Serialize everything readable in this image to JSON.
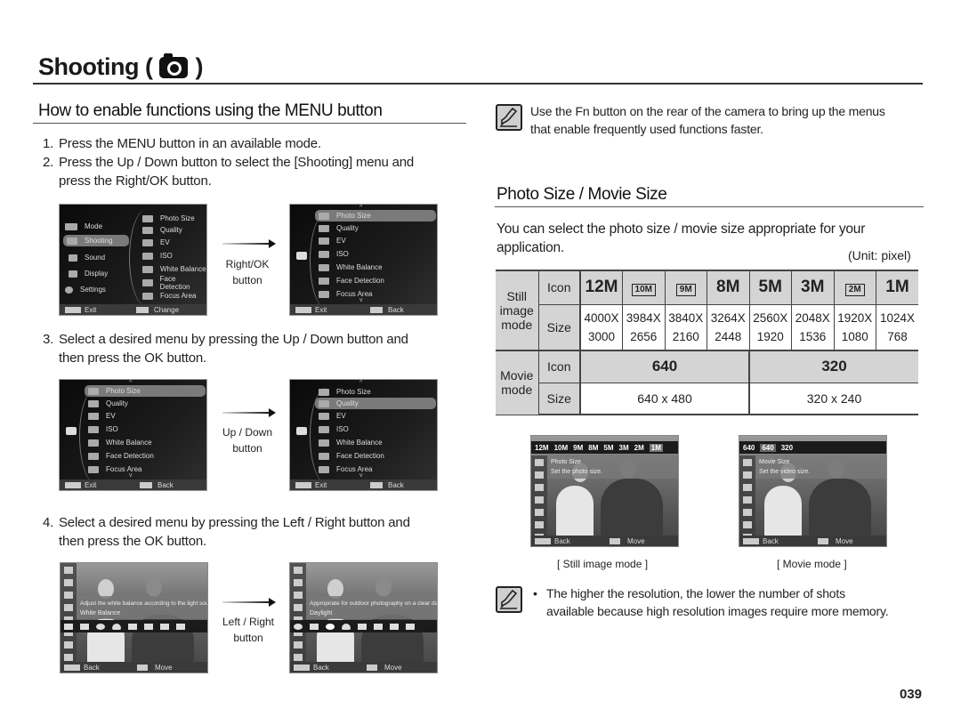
{
  "page": {
    "title": "Shooting (",
    "title_close": ")",
    "title_icon": "camera-icon",
    "page_number": "039"
  },
  "left": {
    "heading": "How to enable functions using the MENU button",
    "steps": [
      {
        "num": "1.",
        "text": "Press the MENU button in an available mode.",
        "cont": ""
      },
      {
        "num": "2.",
        "text": "Press the Up / Down button to select the [Shooting] menu and",
        "cont": "press the Right/OK button."
      },
      {
        "num": "3.",
        "text": "Select a desired menu by pressing the Up / Down button and",
        "cont": "then press the OK button."
      },
      {
        "num": "4.",
        "text": "Select a desired menu by pressing the Left / Right button and",
        "cont": "then press the OK button."
      }
    ],
    "arrows": [
      {
        "line1": "Right/OK",
        "line2": "button"
      },
      {
        "line1": "Up / Down",
        "line2": "button"
      },
      {
        "line1": "Left / Right",
        "line2": "button"
      }
    ],
    "main_menu": {
      "categories": [
        "Mode",
        "Shooting",
        "Sound",
        "Display",
        "Settings"
      ],
      "selected_category": "Shooting",
      "items": [
        "Photo Size",
        "Quality",
        "EV",
        "ISO",
        "White Balance",
        "Face Detection",
        "Focus Area"
      ],
      "footer_left": "Exit",
      "footer_right_change": "Change",
      "footer_right_back": "Back"
    },
    "wb_screen_1": {
      "description": "Adjust the white balance according to the light source.",
      "title": "White Balance",
      "footer_left": "Back",
      "footer_right": "Move"
    },
    "wb_screen_2": {
      "description": "Appropriate for outdoor photography on a clear day.",
      "title": "Daylight",
      "footer_left": "Back",
      "footer_right": "Move"
    }
  },
  "right": {
    "tip": {
      "line1": "Use the Fn button on the rear of the camera to bring up the menus",
      "line2": "that enable frequently used functions faster."
    },
    "heading": "Photo Size / Movie Size",
    "intro_line1": "You can select the photo size / movie size appropriate for your",
    "intro_line2": "application.",
    "unit": "(Unit: pixel)",
    "table": {
      "still_label": [
        "Still",
        "image",
        "mode"
      ],
      "movie_label": [
        "Movie",
        "mode"
      ],
      "icon_label": "Icon",
      "size_label": "Size",
      "still": [
        {
          "icon": "12M",
          "w": "4000X",
          "h": "3000"
        },
        {
          "icon": "10M",
          "w": "3984X",
          "h": "2656"
        },
        {
          "icon": "9M",
          "w": "3840X",
          "h": "2160"
        },
        {
          "icon": "8M",
          "w": "3264X",
          "h": "2448"
        },
        {
          "icon": "5M",
          "w": "2560X",
          "h": "1920"
        },
        {
          "icon": "3M",
          "w": "2048X",
          "h": "1536"
        },
        {
          "icon": "2M",
          "w": "1920X",
          "h": "1080"
        },
        {
          "icon": "1M",
          "w": "1024X",
          "h": "768"
        }
      ],
      "movie": [
        {
          "icon": "640",
          "size": "640 x 480"
        },
        {
          "icon": "320",
          "size": "320 x 240"
        }
      ]
    },
    "still_screen": {
      "bar": [
        "12M",
        "10M",
        "9M",
        "8M",
        "5M",
        "3M",
        "2M",
        "1M"
      ],
      "title": "Photo Size",
      "subtitle": "Set the photo size.",
      "footer_left": "Back",
      "footer_right": "Move",
      "caption": "[ Still image mode ]"
    },
    "movie_screen": {
      "bar": [
        "640",
        "640",
        "320"
      ],
      "title": "Movie Size",
      "subtitle": "Set the video size.",
      "footer_left": "Back",
      "footer_right": "Move",
      "caption": "[ Movie mode ]"
    },
    "note": {
      "bullet": "•",
      "line1": "The higher the resolution, the lower the number of shots",
      "line2": "available because high resolution images require more memory."
    }
  }
}
